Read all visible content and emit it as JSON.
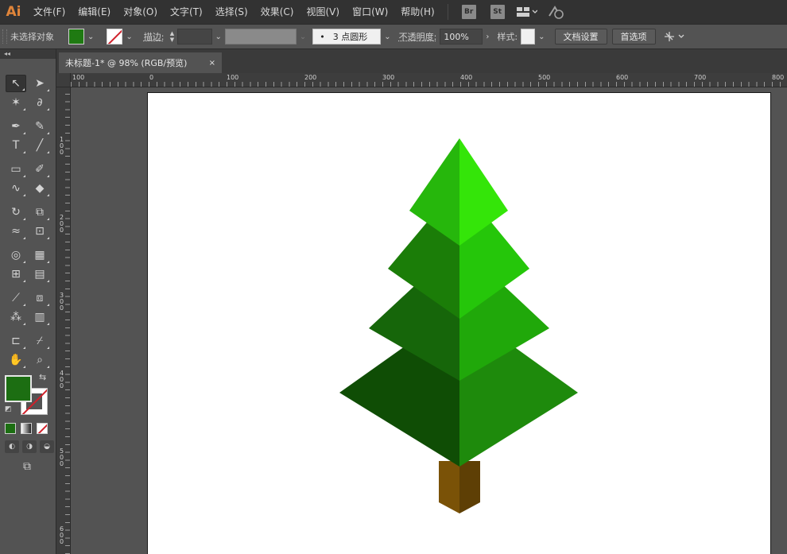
{
  "app": {
    "logo": "Ai"
  },
  "menu": {
    "items": [
      "文件(F)",
      "编辑(E)",
      "对象(O)",
      "文字(T)",
      "选择(S)",
      "效果(C)",
      "视图(V)",
      "窗口(W)",
      "帮助(H)"
    ],
    "badges": [
      "Br",
      "St"
    ],
    "icons": [
      "workspace-layout-icon",
      "sync-icon"
    ]
  },
  "control_bar": {
    "selection_label": "未选择对象",
    "fill_color": "#1f7a12",
    "stroke_label": "描边",
    "stroke_colon": ":",
    "brush_value": "3 点圆形",
    "brush_dot": "•",
    "opacity_label": "不透明度",
    "opacity_colon": ":",
    "opacity_value": "100%",
    "style_label": "样式",
    "style_colon": ":",
    "doc_setup_button": "文档设置",
    "preferences_button": "首选项"
  },
  "toolbar": {
    "collapse_glyph": "◂◂",
    "fill_color": "#1c6e12",
    "tools": [
      {
        "name": "selection-tool",
        "glyph": "↖",
        "active": true
      },
      {
        "name": "direct-selection-tool",
        "glyph": "➤"
      },
      {
        "name": "magic-wand-tool",
        "glyph": "✶"
      },
      {
        "name": "lasso-tool",
        "glyph": "∂"
      },
      {
        "name": "pen-tool",
        "glyph": "✒"
      },
      {
        "name": "curvature-tool",
        "glyph": "✎"
      },
      {
        "name": "type-tool",
        "glyph": "T"
      },
      {
        "name": "line-tool",
        "glyph": "╱"
      },
      {
        "name": "rectangle-tool",
        "glyph": "▭"
      },
      {
        "name": "paintbrush-tool",
        "glyph": "✐"
      },
      {
        "name": "shaper-tool",
        "glyph": "∿"
      },
      {
        "name": "eraser-tool",
        "glyph": "◆"
      },
      {
        "name": "rotate-tool",
        "glyph": "↻"
      },
      {
        "name": "scale-tool",
        "glyph": "⧉"
      },
      {
        "name": "width-tool",
        "glyph": "≈"
      },
      {
        "name": "free-transform-tool",
        "glyph": "⊡"
      },
      {
        "name": "shape-builder-tool",
        "glyph": "◎"
      },
      {
        "name": "perspective-grid-tool",
        "glyph": "▦"
      },
      {
        "name": "mesh-tool",
        "glyph": "⊞"
      },
      {
        "name": "gradient-tool",
        "glyph": "▤"
      },
      {
        "name": "eyedropper-tool",
        "glyph": "⟋"
      },
      {
        "name": "blend-tool",
        "glyph": "⧈"
      },
      {
        "name": "symbol-sprayer-tool",
        "glyph": "⁂"
      },
      {
        "name": "column-graph-tool",
        "glyph": "▥"
      },
      {
        "name": "artboard-tool",
        "glyph": "⊏"
      },
      {
        "name": "slice-tool",
        "glyph": "⌿"
      },
      {
        "name": "hand-tool",
        "glyph": "✋"
      },
      {
        "name": "zoom-tool",
        "glyph": "⌕"
      }
    ],
    "swap_glyph": "⇆",
    "default_glyph": "◩",
    "draw_modes": [
      "◐",
      "◑",
      "◒"
    ],
    "screen_mode_glyph": "⧉"
  },
  "tab": {
    "title": "未标题-1* @ 98% (RGB/预览)",
    "close": "×"
  },
  "rulers": {
    "horizontal": [
      "100",
      "0",
      "100",
      "200",
      "300",
      "400",
      "500",
      "600",
      "700",
      "800"
    ],
    "vertical": [
      "100",
      "200",
      "300",
      "400",
      "500",
      "600"
    ]
  },
  "artwork": {
    "tree_colors": {
      "top_left": "#26b70c",
      "top_right": "#34e509",
      "tier2_left": "#1b7d08",
      "tier2_right": "#25c60a",
      "tier3_left": "#16660a",
      "tier3_right": "#20a80a",
      "tier4_left": "#0f4d05",
      "tier4_right": "#1e8a0c",
      "trunk_left": "#7a5207",
      "trunk_right": "#5e3f05"
    }
  }
}
